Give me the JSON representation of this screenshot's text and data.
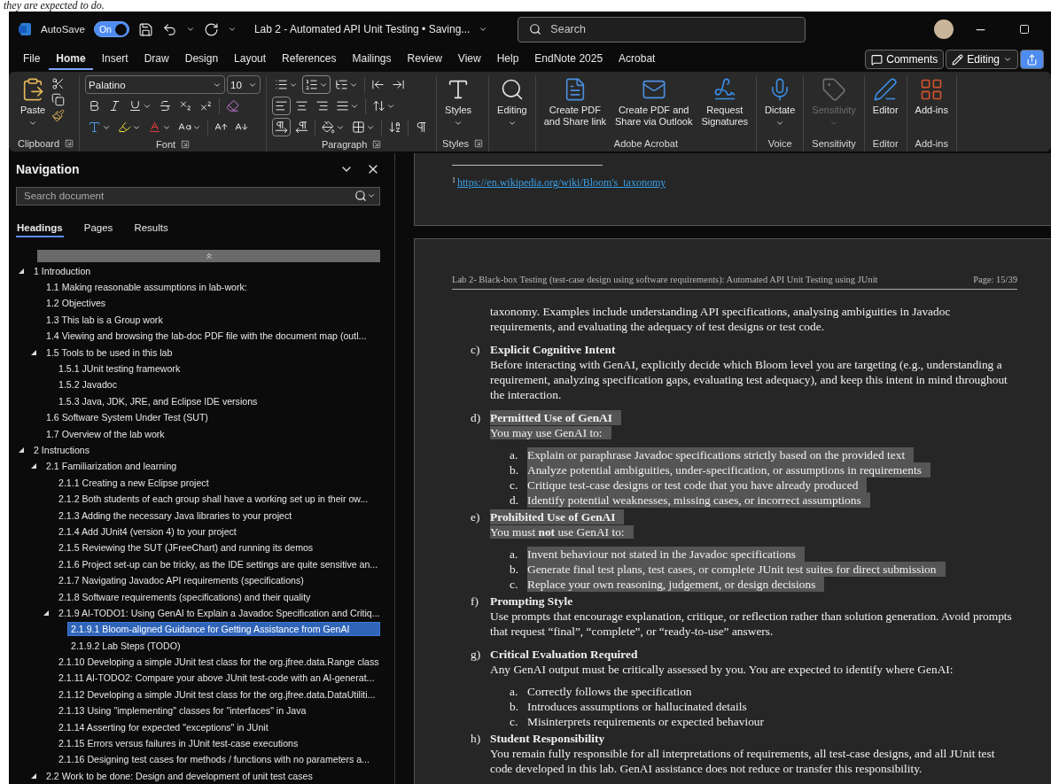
{
  "page_fragment": "they are expected to do.",
  "title_bar": {
    "autosave_label": "AutoSave",
    "autosave": {
      "on": true,
      "label": "On"
    },
    "document_title": "Lab 2 - Automated API Unit Testing • Saving...",
    "search": {
      "placeholder": "Search"
    }
  },
  "menu_tabs": [
    {
      "label": "File",
      "selected": false
    },
    {
      "label": "Home",
      "selected": true
    },
    {
      "label": "Insert",
      "selected": false
    },
    {
      "label": "Draw",
      "selected": false
    },
    {
      "label": "Design",
      "selected": false
    },
    {
      "label": "Layout",
      "selected": false
    },
    {
      "label": "References",
      "selected": false
    },
    {
      "label": "Mailings",
      "selected": false
    },
    {
      "label": "Review",
      "selected": false
    },
    {
      "label": "View",
      "selected": false
    },
    {
      "label": "Help",
      "selected": false
    },
    {
      "label": "EndNote 2025",
      "selected": false
    },
    {
      "label": "Acrobat",
      "selected": false
    }
  ],
  "header_buttons": [
    {
      "kind": "comments",
      "label": "Comments"
    },
    {
      "kind": "editing",
      "label": "Editing"
    },
    {
      "kind": "share"
    }
  ],
  "ribbon": {
    "groups": [
      {
        "kind": "clipboard",
        "label": "Clipboard",
        "buttons": [
          {
            "kind": "paste",
            "label": "Paste",
            "disabled": false
          }
        ]
      },
      {
        "kind": "font",
        "label": "Font",
        "font_name": "Palatino",
        "font_size": "10"
      },
      {
        "kind": "paragraph",
        "label": "Paragraph",
        "active_tools": {
          "numbering": true,
          "align_left": true,
          "left_to_right": true
        }
      },
      {
        "kind": "large",
        "label": "Styles",
        "buttons": [
          {
            "kind": "styles",
            "label": "Styles",
            "disabled": false
          }
        ]
      },
      {
        "kind": "large",
        "buttons": [
          {
            "kind": "editing",
            "label": "Editing",
            "disabled": false
          }
        ]
      },
      {
        "kind": "large",
        "label": "Adobe Acrobat",
        "buttons": [
          {
            "kind": "pdf-link",
            "label": "Create PDF\nand Share link",
            "disabled": false
          },
          {
            "kind": "pdf-mail",
            "label": "Create PDF and\nShare via Outlook",
            "disabled": false
          },
          {
            "kind": "signature",
            "label": "Request\nSignatures",
            "disabled": false
          }
        ]
      },
      {
        "kind": "large",
        "label": "Voice",
        "buttons": [
          {
            "kind": "dictate",
            "label": "Dictate",
            "disabled": false
          }
        ]
      },
      {
        "kind": "large",
        "label": "Sensitivity",
        "buttons": [
          {
            "kind": "sensitivity",
            "label": "Sensitivity",
            "disabled": true
          }
        ]
      },
      {
        "kind": "large",
        "label": "Editor",
        "buttons": [
          {
            "kind": "editor",
            "label": "Editor",
            "disabled": false
          }
        ]
      },
      {
        "kind": "large",
        "label": "Add-ins",
        "buttons": [
          {
            "kind": "addins",
            "label": "Add-ins",
            "disabled": false
          }
        ]
      }
    ]
  },
  "navigation": {
    "title": "Navigation",
    "search": {
      "placeholder": "Search document"
    },
    "tabs": [
      {
        "label": "Headings",
        "selected": true
      },
      {
        "label": "Pages",
        "selected": false
      },
      {
        "label": "Results",
        "selected": false
      }
    ],
    "headings": [
      {
        "label": "1 Introduction",
        "selected": false,
        "expanded": true,
        "children": [
          {
            "label": "1.1 Making reasonable assumptions in lab-work:",
            "selected": false
          },
          {
            "label": "1.2 Objectives",
            "selected": false
          },
          {
            "label": "1.3 This lab is a Group work",
            "selected": false
          },
          {
            "label": "1.4 Viewing and browsing the lab-doc PDF file with the document map (outl...",
            "selected": false
          },
          {
            "label": "1.5 Tools to be used in this lab",
            "selected": false,
            "expanded": true,
            "children": [
              {
                "label": "1.5.1 JUnit testing framework",
                "selected": false
              },
              {
                "label": "1.5.2 Javadoc",
                "selected": false
              },
              {
                "label": "1.5.3 Java, JDK, JRE, and Eclipse IDE versions",
                "selected": false
              }
            ]
          },
          {
            "label": "1.6 Software System Under Test (SUT)",
            "selected": false
          },
          {
            "label": "1.7 Overview of the lab work",
            "selected": false
          }
        ]
      },
      {
        "label": "2 Instructions",
        "selected": false,
        "expanded": true,
        "children": [
          {
            "label": "2.1 Familiarization and learning",
            "selected": false,
            "expanded": true,
            "children": [
              {
                "label": "2.1.1 Creating a new Eclipse project",
                "selected": false
              },
              {
                "label": "2.1.2 Both students of each group shall have a working set up in their ow...",
                "selected": false
              },
              {
                "label": "2.1.3 Adding the necessary Java libraries to your project",
                "selected": false
              },
              {
                "label": "2.1.4 Add JUnit4 (version 4) to your project",
                "selected": false
              },
              {
                "label": "2.1.5 Reviewing the SUT (JFreeChart) and running its demos",
                "selected": false
              },
              {
                "label": "2.1.6 Project set-up can be tricky, as the IDE settings are quite sensitive an...",
                "selected": false
              },
              {
                "label": "2.1.7 Navigating Javadoc API requirements (specifications)",
                "selected": false
              },
              {
                "label": "2.1.8 Software requirements (specifications) and their quality",
                "selected": false
              },
              {
                "label": "2.1.9 AI-TODO1: Using GenAI to Explain a Javadoc Specification and Critiq...",
                "selected": false,
                "expanded": true,
                "children": [
                  {
                    "label": "2.1.9.1 Bloom-aligned Guidance for Getting Assistance from GenAI",
                    "selected": true
                  },
                  {
                    "label": "2.1.9.2 Lab Steps (TODO)",
                    "selected": false
                  }
                ]
              },
              {
                "label": "2.1.10 Developing a simple JUnit test class for the org.jfree.data.Range class",
                "selected": false
              },
              {
                "label": "2.1.11 AI-TODO2: Compare your above JUnit test-code with an AI-generat...",
                "selected": false
              },
              {
                "label": "2.1.12 Developing a simple JUnit test class for the org.jfree.data.DataUtiliti...",
                "selected": false
              },
              {
                "label": "2.1.13 Using \"implementing\" classes for \"interfaces\" in Java",
                "selected": false
              },
              {
                "label": "2.1.14 Asserting for expected \"exceptions\" in JUnit",
                "selected": false
              },
              {
                "label": "2.1.15 Errors versus failures in JUnit test-case executions",
                "selected": false
              },
              {
                "label": "2.1.16 Designing test cases for methods / functions with no parameters a...",
                "selected": false
              }
            ]
          },
          {
            "label": "2.2 Work to be done: Design and development of unit test cases",
            "selected": false,
            "expanded": true
          }
        ]
      }
    ]
  },
  "document": {
    "footnote": {
      "marker": "1",
      "link": "https://en.wikipedia.org/wiki/Bloom's_taxonomy"
    },
    "page": {
      "header": "Lab 2- Black-box Testing (test-case design using software requirements): Automated API Unit Testing using JUnit",
      "page_number": "Page: 15/39",
      "continuation": "taxonomy. Examples include understanding API specifications, analysing ambiguities in Javadoc requirements, and evaluating the adequacy of test designs or test code.",
      "sections": [
        {
          "marker": "c)",
          "title": "Explicit Cognitive Intent",
          "body": "Before interacting with GenAI, explicitly decide which Bloom level you are targeting (e.g., understanding a requirement, analyzing specification gaps, evaluating test adequacy), and keep this intent in mind throughout the interaction.",
          "highlighted": false
        },
        {
          "marker": "d)",
          "title": "Permitted Use of GenAI",
          "body": "You may use GenAI to:",
          "highlighted": true,
          "items": [
            {
              "marker": "a.",
              "text": "Explain or paraphrase Javadoc specifications strictly based on the provided text"
            },
            {
              "marker": "b.",
              "text": "Analyze potential ambiguities, under-specification, or assumptions in requirements"
            },
            {
              "marker": "c.",
              "text": "Critique test-case designs or test code that you have already produced"
            },
            {
              "marker": "d.",
              "text": "Identify potential weaknesses, missing cases, or incorrect assumptions"
            }
          ]
        },
        {
          "marker": "e)",
          "title": "Prohibited Use of GenAI",
          "body": "You must **not** use GenAI to:",
          "highlighted": true,
          "items": [
            {
              "marker": "a.",
              "text": "Invent behaviour not stated in the Javadoc specifications"
            },
            {
              "marker": "b.",
              "text": "Generate final test plans, test cases, or complete JUnit test suites for direct submission"
            },
            {
              "marker": "c.",
              "text": "Replace your own reasoning, judgement, or design decisions"
            }
          ]
        },
        {
          "marker": "f)",
          "title": "Prompting Style",
          "body": "Use prompts that encourage explanation, critique, or reflection rather than solution generation. Avoid prompts that request “final”, “complete”, or “ready-to-use” answers.",
          "highlighted": false
        },
        {
          "marker": "g)",
          "title": "Critical Evaluation Required",
          "body": "Any GenAI output must be critically assessed by you. You are expected to identify where GenAI:",
          "highlighted": false,
          "items": [
            {
              "marker": "a.",
              "text": "Correctly follows the specification"
            },
            {
              "marker": "b.",
              "text": "Introduces assumptions or hallucinated details"
            },
            {
              "marker": "c.",
              "text": "Misinterprets requirements or expected behaviour"
            }
          ]
        },
        {
          "marker": "h)",
          "title": "Student Responsibility",
          "body": "You remain fully responsible for all interpretations of requirements, all test-case designs, and all JUnit test code developed in this lab. GenAI assistance does not reduce or transfer this responsibility.",
          "highlighted": false
        }
      ]
    }
  }
}
